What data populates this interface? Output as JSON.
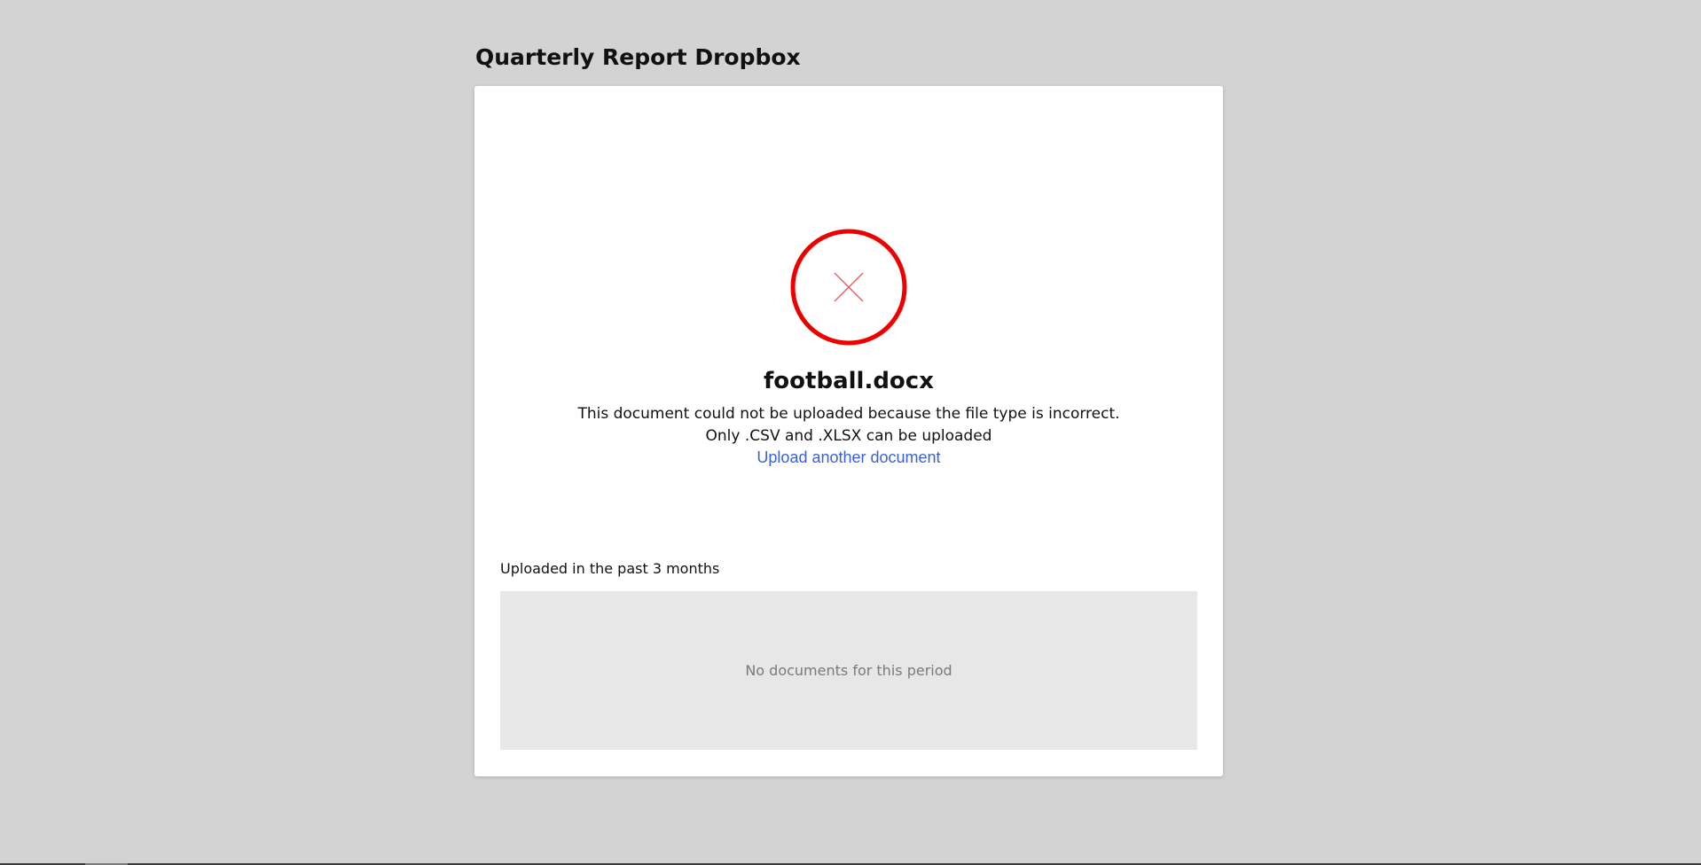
{
  "page": {
    "title": "Quarterly Report Dropbox",
    "background_color": "#d3d3d3"
  },
  "upload_result": {
    "status": "error",
    "icon": "close-icon",
    "icon_color": "#ee0000",
    "file_name": "football.docx",
    "message_line1": "This document could not be uploaded because the file type is incorrect.",
    "message_line2": "Only .CSV and .XLSX can be uploaded",
    "action_link_label": "Upload another document",
    "link_color": "#3a5fd9"
  },
  "history": {
    "heading": "Uploaded in the past 3 months",
    "empty_message": "No documents for this period"
  }
}
